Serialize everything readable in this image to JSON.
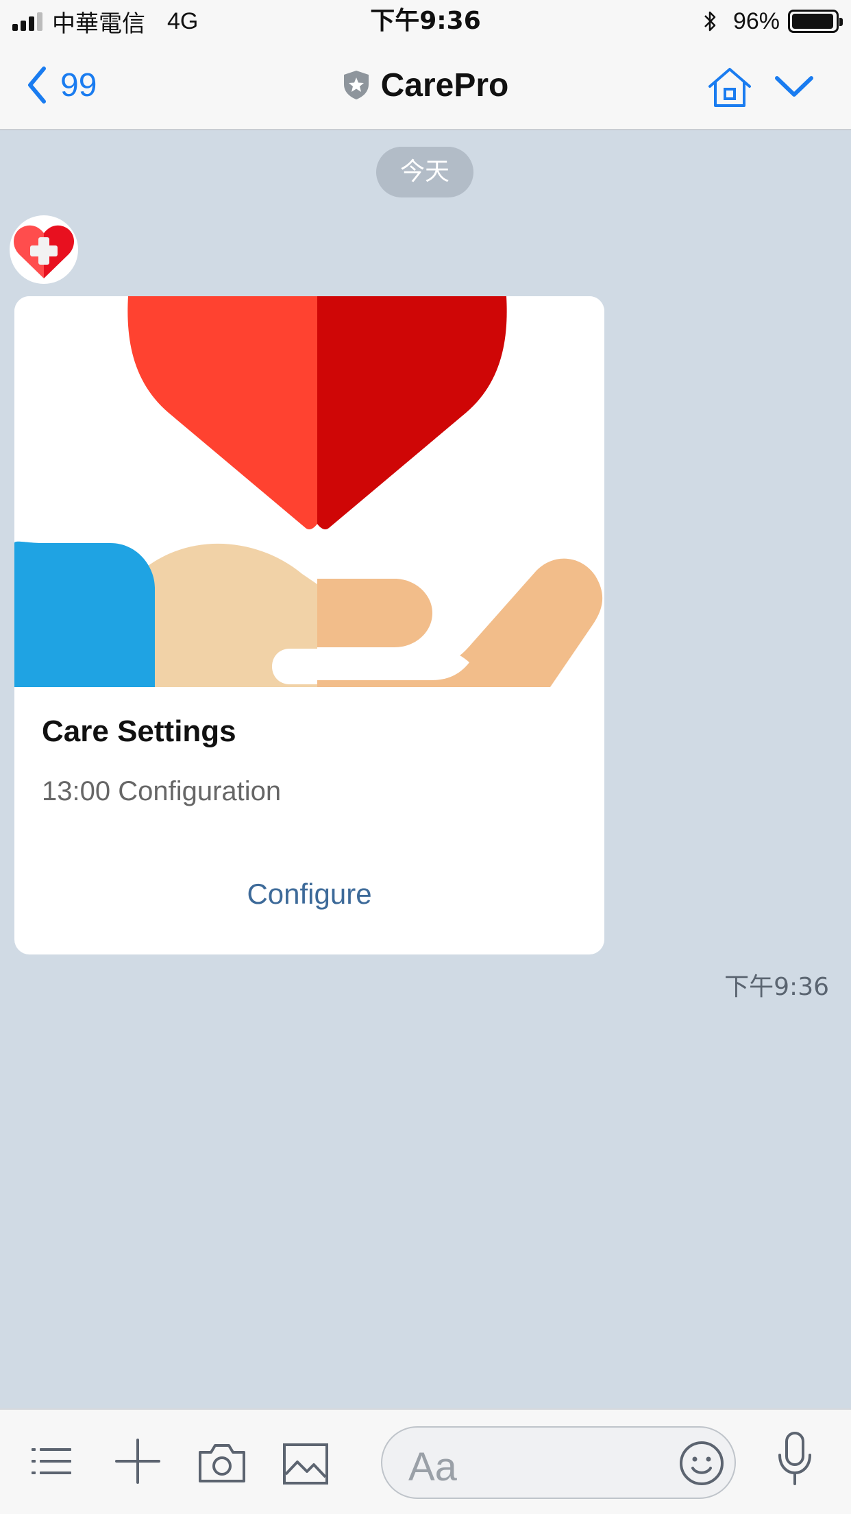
{
  "status_bar": {
    "carrier": "中華電信",
    "network": "4G",
    "time": "下午9:36",
    "battery_percent": "96%",
    "battery_level": 0.96
  },
  "nav": {
    "back_count": "99",
    "title": "CarePro",
    "icons": [
      "chevron-left-icon",
      "shield-star-icon",
      "home-icon",
      "chevron-down-icon"
    ]
  },
  "chat": {
    "date_label": "今天",
    "card": {
      "title": "Care Settings",
      "subtitle": "13:00 Configuration",
      "action_label": "Configure"
    },
    "message_time": "下午9:36"
  },
  "toolbar": {
    "input_placeholder": "Aa",
    "icons": [
      "menu-icon",
      "plus-icon",
      "camera-icon",
      "image-icon",
      "emoji-icon",
      "microphone-icon"
    ]
  },
  "colors": {
    "accent": "#1a7cf0",
    "chat_background": "#d0dae4",
    "link": "#3d6a99",
    "heart_light": "#ff4230",
    "heart_dark": "#cf0606",
    "sleeve": "#1fa3e3",
    "hand_light": "#f1d2a7",
    "hand_dark": "#f2bd8a"
  }
}
